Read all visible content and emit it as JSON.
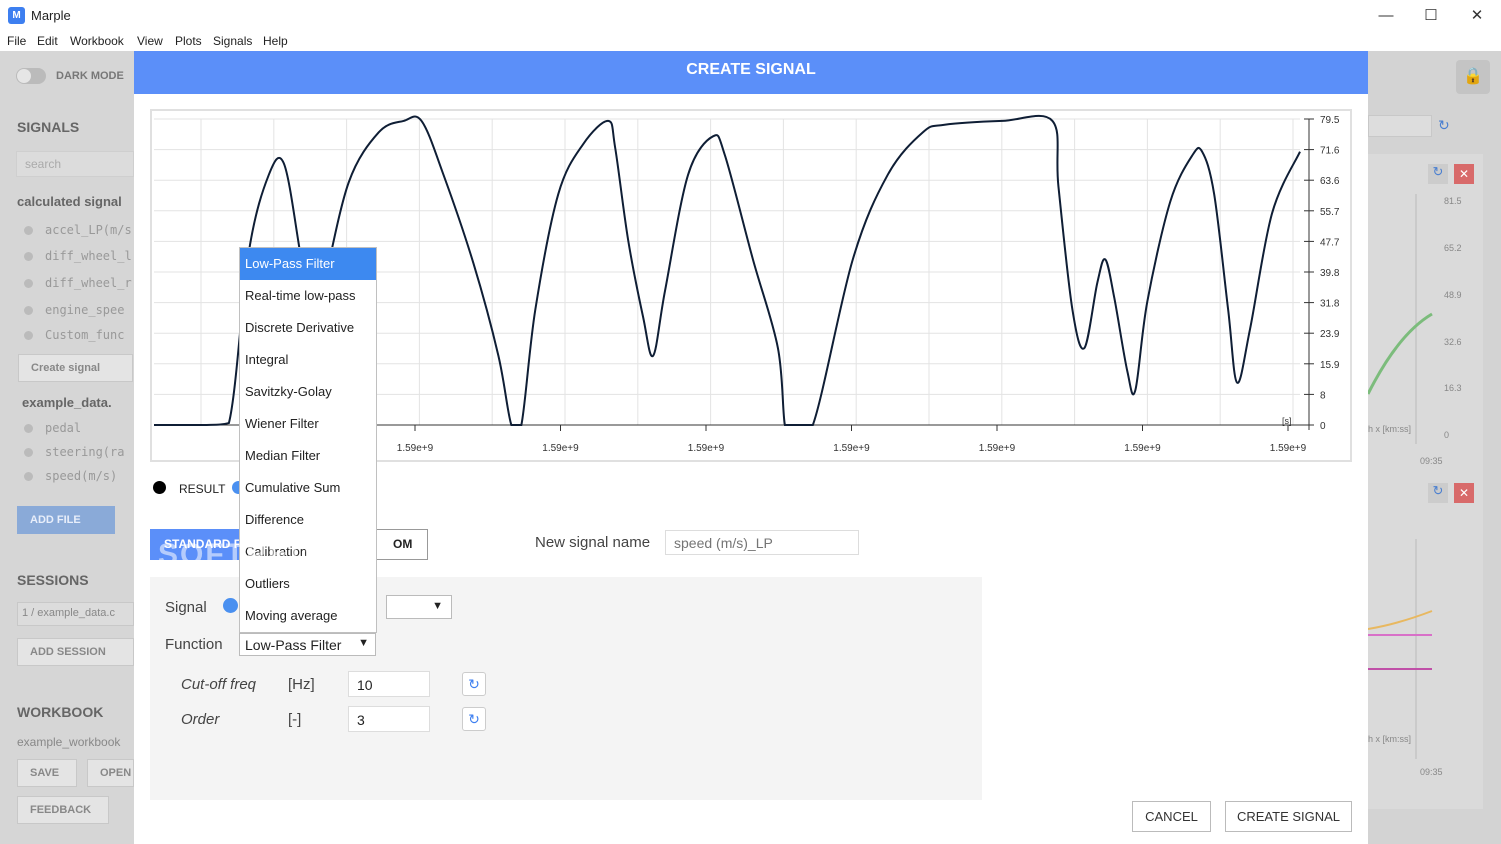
{
  "app": {
    "title": "Marple",
    "icon_label": "M"
  },
  "window_controls": {
    "minimize": "—",
    "maximize": "☐",
    "close": "✕"
  },
  "menu": [
    "File",
    "Edit",
    "Workbook",
    "View",
    "Plots",
    "Signals",
    "Help"
  ],
  "sidebar": {
    "dark_mode": "DARK MODE",
    "signals_head": "SIGNALS",
    "search_placeholder": "search",
    "calculated_head": "calculated signal",
    "calculated": [
      "accel_LP(m/s",
      "diff_wheel_l",
      "diff_wheel_r",
      "engine_spee",
      "Custom_func"
    ],
    "create_signal": "Create signal",
    "file_head": "example_data.",
    "file_signals": [
      "pedal",
      "steering(ra",
      "speed(m/s)"
    ],
    "add_file": "ADD FILE",
    "sessions_head": "SESSIONS",
    "session_item": "1 / example_data.c",
    "add_session": "ADD SESSION",
    "workbook_head": "WORKBOOK",
    "workbook_name": "example_workbook",
    "save": "SAVE",
    "open": "OPEN",
    "feedback": "FEEDBACK"
  },
  "right_panel": {
    "chart1_ticks": [
      "81.5",
      "65.2",
      "48.9",
      "32.6",
      "16.3",
      "0"
    ],
    "chart1_xlabel": "09:35",
    "chart1_axis": "h x [km:ss]",
    "chart2_xlabel": "09:35",
    "chart2_axis": "h x [km:ss]"
  },
  "modal": {
    "title": "CREATE SIGNAL",
    "legend_result": "RESULT",
    "tab_standard": "STANDARD F",
    "tab_custom": "OM",
    "new_signal_label": "New signal name",
    "new_signal_placeholder": "speed (m/s)_LP",
    "signal_label": "Signal",
    "function_label": "Function",
    "function_value": "Low-Pass Filter",
    "params": [
      {
        "name": "Cut-off freq",
        "unit": "[Hz]",
        "value": "10"
      },
      {
        "name": "Order",
        "unit": "[-]",
        "value": "3"
      }
    ],
    "cancel": "CANCEL",
    "create": "CREATE SIGNAL"
  },
  "dropdown": {
    "items": [
      "Low-Pass Filter",
      "Real-time low-pass",
      "Discrete Derivative",
      "Integral",
      "Savitzky-Golay",
      "Wiener Filter",
      "Median Filter",
      "Cumulative Sum",
      "Difference",
      "Calibration",
      "Outliers",
      "Moving average"
    ],
    "selected_index": 0
  },
  "watermark": "SOFTPEDIA",
  "colors": {
    "accent": "#5b8ff9",
    "selected": "#3d89f0",
    "series": "#0f1e35",
    "legend_blue": "#4a90f0"
  },
  "chart_data": {
    "type": "line",
    "title": "",
    "xlabel": "[s]",
    "ylabel": "",
    "y_ticks": [
      "0",
      "8",
      "15.9",
      "23.9",
      "31.8",
      "39.8",
      "47.7",
      "55.7",
      "63.6",
      "71.6",
      "79.5"
    ],
    "x_ticks": [
      "1.59e+9",
      "1.59e+9",
      "1.59e+9",
      "1.59e+9",
      "1.59e+9",
      "1.59e+9",
      "1.59e+9"
    ],
    "ylim": [
      0,
      79.5
    ],
    "grid": true,
    "series": [
      {
        "name": "RESULT",
        "points": [
          [
            0,
            0
          ],
          [
            50,
            0
          ],
          [
            75,
            0.5
          ],
          [
            95,
            45
          ],
          [
            115,
            65
          ],
          [
            130,
            68
          ],
          [
            145,
            47
          ],
          [
            158,
            23
          ],
          [
            170,
            36
          ],
          [
            195,
            63
          ],
          [
            225,
            76
          ],
          [
            250,
            79
          ],
          [
            268,
            79
          ],
          [
            290,
            65
          ],
          [
            320,
            42
          ],
          [
            345,
            18
          ],
          [
            358,
            0
          ],
          [
            368,
            0
          ],
          [
            382,
            30
          ],
          [
            405,
            60
          ],
          [
            430,
            73
          ],
          [
            455,
            79
          ],
          [
            462,
            72
          ],
          [
            475,
            48
          ],
          [
            490,
            28
          ],
          [
            500,
            18
          ],
          [
            512,
            35
          ],
          [
            535,
            65
          ],
          [
            560,
            75
          ],
          [
            572,
            70
          ],
          [
            600,
            43
          ],
          [
            625,
            20
          ],
          [
            632,
            0
          ],
          [
            640,
            0
          ],
          [
            660,
            0
          ],
          [
            700,
            43
          ],
          [
            735,
            65
          ],
          [
            770,
            76
          ],
          [
            792,
            78
          ],
          [
            850,
            79
          ],
          [
            900,
            79
          ],
          [
            906,
            62
          ],
          [
            920,
            30
          ],
          [
            932,
            20
          ],
          [
            945,
            37
          ],
          [
            953,
            43
          ],
          [
            962,
            33
          ],
          [
            975,
            14
          ],
          [
            983,
            9
          ],
          [
            995,
            32
          ],
          [
            1018,
            58
          ],
          [
            1040,
            70
          ],
          [
            1050,
            71
          ],
          [
            1062,
            60
          ],
          [
            1076,
            30
          ],
          [
            1085,
            11
          ],
          [
            1098,
            25
          ],
          [
            1120,
            55
          ],
          [
            1148,
            71
          ]
        ]
      }
    ]
  }
}
